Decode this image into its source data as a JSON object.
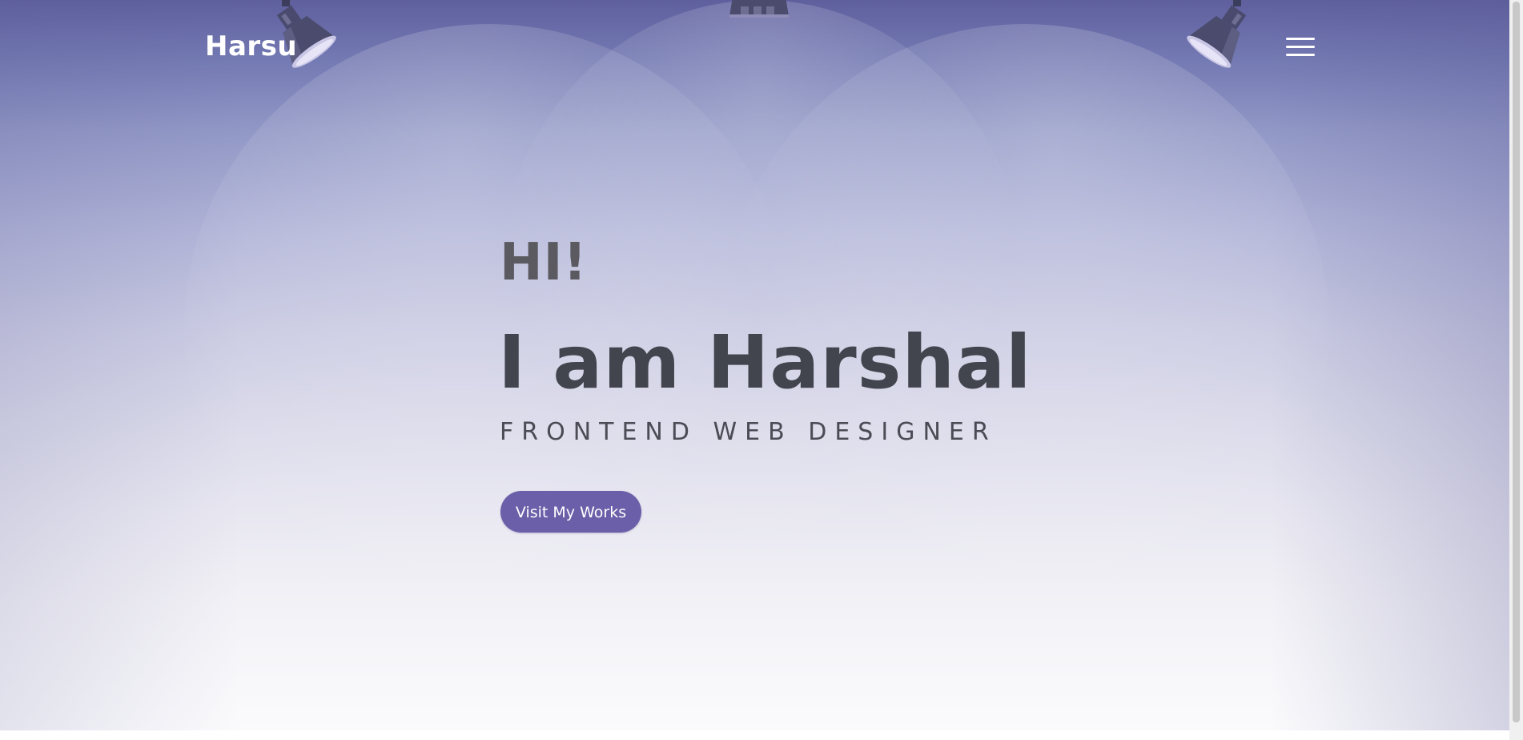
{
  "header": {
    "logo_text": "Harsu",
    "menu_icon": "hamburger-menu-icon"
  },
  "hero": {
    "greeting": "HI!",
    "headline": "I am Harshal",
    "subtitle": "FRONTEND WEB DESIGNER",
    "cta_label": "Visit My Works"
  },
  "decor": {
    "lamps": [
      "spotlight-left-icon",
      "spotlight-center-icon",
      "spotlight-right-icon"
    ]
  },
  "colors": {
    "accent": "#6a5fa8",
    "header_bg": "#5f5f9e",
    "headline_text": "#42454d",
    "greeting_text": "#5a5a60",
    "subtitle_text": "#4a4c55",
    "logo_text": "#ffffff"
  }
}
